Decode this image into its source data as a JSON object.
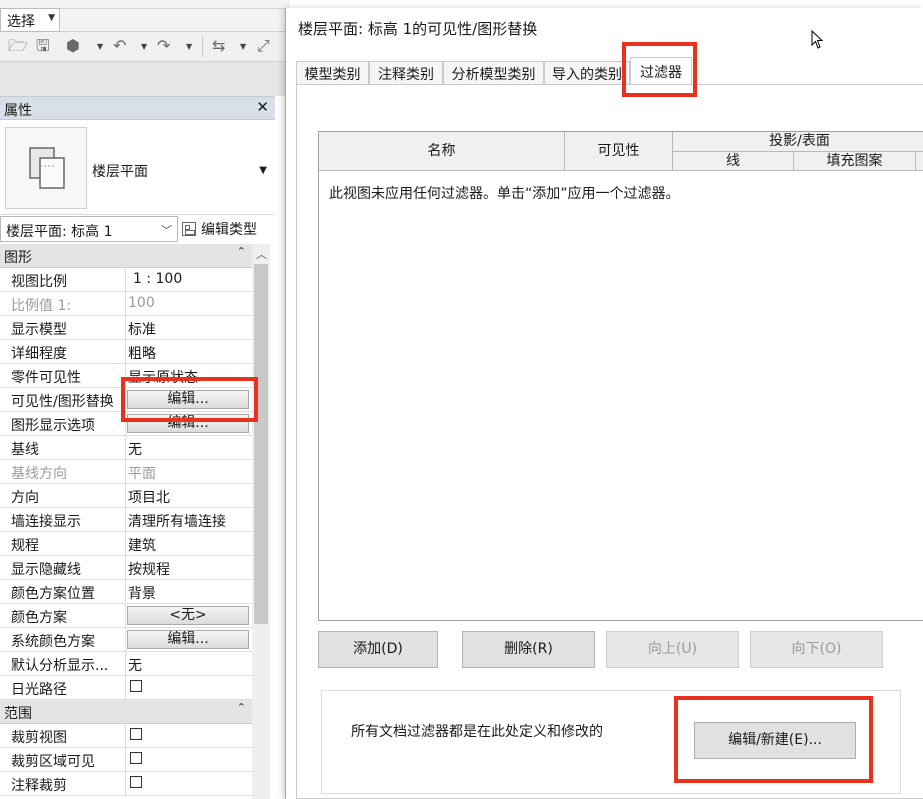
{
  "toolbar": {
    "select_label": "选择"
  },
  "qat": {
    "icons": [
      "open-icon",
      "save-icon",
      "sync-icon",
      "undo-icon",
      "redo-icon",
      "measure-icon",
      "dimension-icon"
    ]
  },
  "properties": {
    "title": "属性",
    "close_glyph": "✕",
    "type_name": "楼层平面",
    "view_selector": "楼层平面: 标高 1",
    "edit_type": "编辑类型",
    "groups": [
      {
        "name": "图形",
        "rows": [
          {
            "key": "视图比例",
            "value": "1 : 100"
          },
          {
            "key": "比例值 1:",
            "value": "100"
          },
          {
            "key": "显示模型",
            "value": "标准"
          },
          {
            "key": "详细程度",
            "value": "粗略"
          },
          {
            "key": "零件可见性",
            "value": "显示原状态"
          },
          {
            "key": "可见性/图形替换",
            "value": "编辑..."
          },
          {
            "key": "图形显示选项",
            "value": "编辑..."
          },
          {
            "key": "基线",
            "value": "无"
          },
          {
            "key": "基线方向",
            "value": "平面"
          },
          {
            "key": "方向",
            "value": "项目北"
          },
          {
            "key": "墙连接显示",
            "value": "清理所有墙连接"
          },
          {
            "key": "规程",
            "value": "建筑"
          },
          {
            "key": "显示隐藏线",
            "value": "按规程"
          },
          {
            "key": "颜色方案位置",
            "value": "背景"
          },
          {
            "key": "颜色方案",
            "value": "<无>"
          },
          {
            "key": "系统颜色方案",
            "value": "编辑..."
          },
          {
            "key": "默认分析显示...",
            "value": "无"
          },
          {
            "key": "日光路径",
            "value": ""
          }
        ]
      },
      {
        "name": "范围",
        "rows": [
          {
            "key": "裁剪视图",
            "value": ""
          },
          {
            "key": "裁剪区域可见",
            "value": ""
          },
          {
            "key": "注释裁剪",
            "value": ""
          }
        ]
      }
    ]
  },
  "dialog": {
    "title": "楼层平面: 标高 1的可见性/图形替换",
    "tabs": [
      "模型类别",
      "注释类别",
      "分析模型类别",
      "导入的类别",
      "过滤器"
    ],
    "active_tab": "过滤器",
    "table": {
      "col_name": "名称",
      "col_visibility": "可见性",
      "col_projection": "投影/表面",
      "sub_line": "线",
      "sub_fill": "填充图案"
    },
    "empty_message": "此视图未应用任何过滤器。单击“添加”应用一个过滤器。",
    "buttons": {
      "add": "添加(D)",
      "delete": "删除(R)",
      "up": "向上(U)",
      "down": "向下(O)"
    },
    "footer_text": "所有文档过滤器都是在此处定义和修改的",
    "edit_new": "编辑/新建(E)..."
  },
  "colors": {
    "highlight_red": "#e8321e",
    "panel_header": "#d9dfe8"
  }
}
